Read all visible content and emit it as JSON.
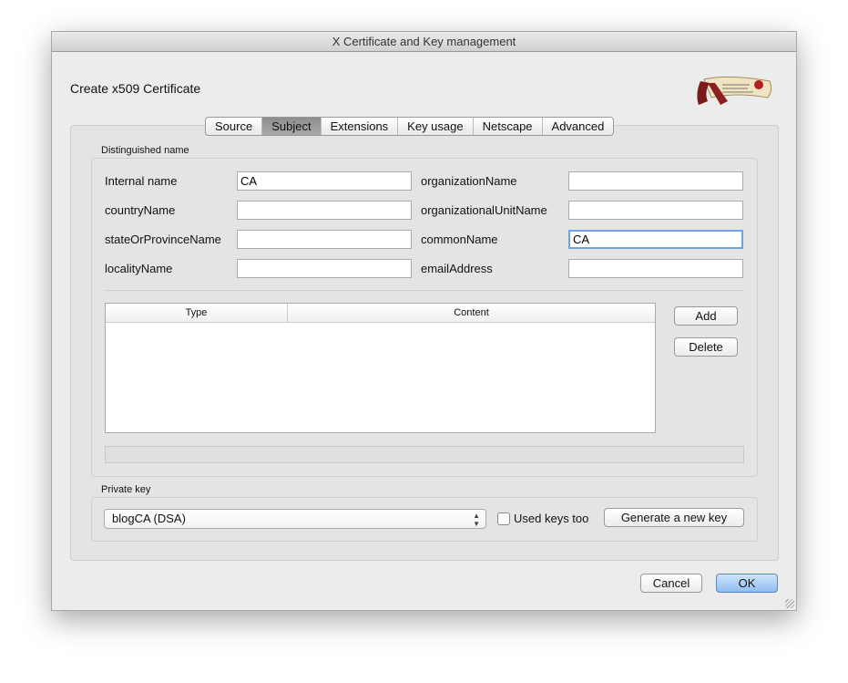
{
  "window": {
    "title": "X Certificate and Key management"
  },
  "header": {
    "title": "Create x509 Certificate",
    "logo": "xca-scroll-logo"
  },
  "tabs": [
    {
      "label": "Source"
    },
    {
      "label": "Subject",
      "selected": true
    },
    {
      "label": "Extensions"
    },
    {
      "label": "Key usage"
    },
    {
      "label": "Netscape"
    },
    {
      "label": "Advanced"
    }
  ],
  "distinguished": {
    "group_label": "Distinguished name",
    "left": [
      {
        "label": "Internal name",
        "value": "CA"
      },
      {
        "label": "countryName",
        "value": ""
      },
      {
        "label": "stateOrProvinceName",
        "value": ""
      },
      {
        "label": "localityName",
        "value": ""
      }
    ],
    "right": [
      {
        "label": "organizationName",
        "value": ""
      },
      {
        "label": "organizationalUnitName",
        "value": ""
      },
      {
        "label": "commonName",
        "value": "CA"
      },
      {
        "label": "emailAddress",
        "value": ""
      }
    ],
    "table": {
      "columns": [
        "Type",
        "Content"
      ],
      "rows": []
    },
    "add_label": "Add",
    "delete_label": "Delete"
  },
  "private_key": {
    "group_label": "Private key",
    "selected": "blogCA (DSA)",
    "used_keys_label": "Used keys too",
    "used_keys_checked": false,
    "generate_label": "Generate a new key"
  },
  "footer": {
    "cancel": "Cancel",
    "ok": "OK"
  },
  "colors": {
    "focus": "#6fa3e0",
    "ok_button": "#a9cdf3"
  }
}
